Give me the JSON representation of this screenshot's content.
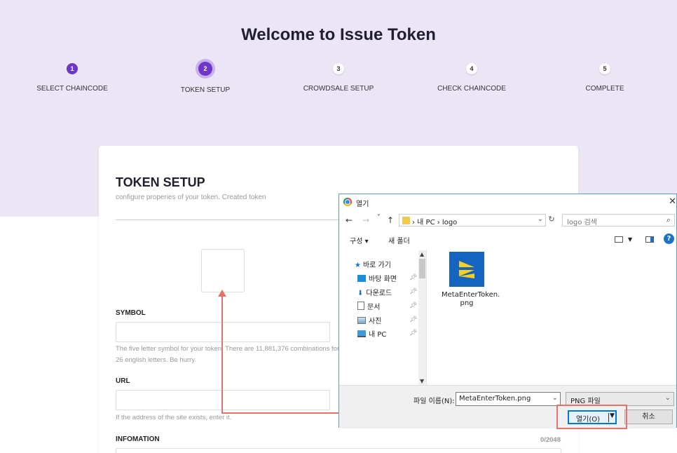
{
  "page": {
    "title": "Welcome to Issue Token",
    "steps": [
      {
        "num": "1",
        "label": "SELECT CHAINCODE"
      },
      {
        "num": "2",
        "label": "TOKEN SETUP"
      },
      {
        "num": "3",
        "label": "CROWDSALE SETUP"
      },
      {
        "num": "4",
        "label": "CHECK CHAINCODE"
      },
      {
        "num": "5",
        "label": "COMPLETE"
      }
    ],
    "active_step": 2
  },
  "card": {
    "title": "TOKEN SETUP",
    "description": "configure properies of your token. Created token",
    "symbol": {
      "label": "SYMBOL",
      "help": "The five letter symbol for your token. There are 11,881,376 combinations for 26 english letters. Be hurry."
    },
    "url": {
      "label": "URL",
      "help": "If the address of the site exists, enter it."
    },
    "information": {
      "label": "INFOMATION",
      "counter": "0/2048"
    }
  },
  "dialog": {
    "title": "열기",
    "close": "✕",
    "nav": {
      "back": "←",
      "forward": "→",
      "recent": "˅",
      "up": "↑",
      "refresh": "↻"
    },
    "breadcrumb": "›  내 PC  ›  logo",
    "search_placeholder": "logo 검색",
    "toolbar": {
      "organize": "구성 ▾",
      "new_folder": "새 폴더",
      "help": "?"
    },
    "nav_items": [
      {
        "label": "바로 가기",
        "icon": "star-icon"
      },
      {
        "label": "바탕 화면",
        "icon": "desktop-icon"
      },
      {
        "label": "다운로드",
        "icon": "download-icon"
      },
      {
        "label": "문서",
        "icon": "document-icon"
      },
      {
        "label": "사진",
        "icon": "picture-icon"
      },
      {
        "label": "내 PC",
        "icon": "pc-icon"
      }
    ],
    "file": {
      "name": "MetaEnterToken.png",
      "name_line1": "MetaEnterToken.",
      "name_line2": "png"
    },
    "filename_label": "파일 이름(N):",
    "filename_value": "MetaEnterToken.png",
    "filetype": "PNG 파일",
    "open_label": "열기(O)",
    "cancel_label": "취소"
  },
  "colors": {
    "accent": "#6e36c9",
    "hero_bg": "#ece5f5",
    "annotation": "#e8706a",
    "dialog_border": "#5b9bd5"
  }
}
